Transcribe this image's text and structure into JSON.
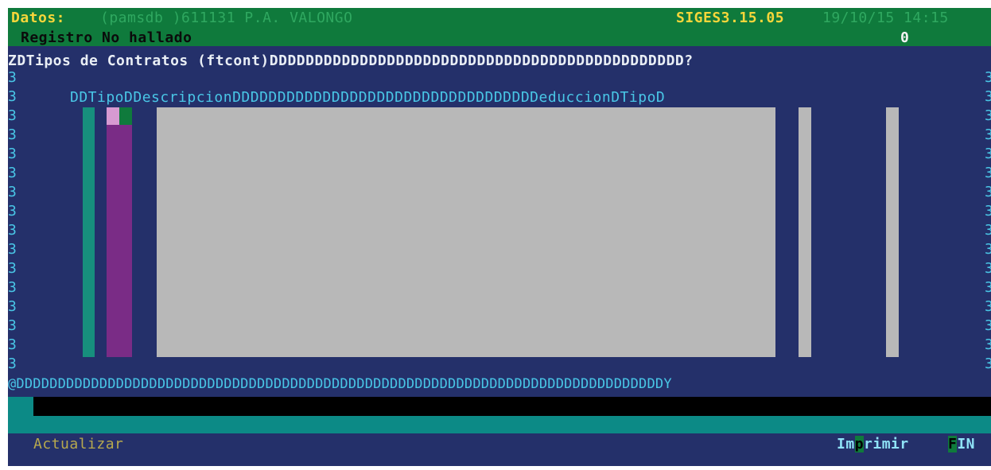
{
  "header": {
    "datos_label": "Datos:",
    "db_name": "(pamsdb  )611131 P.A. VALONGO",
    "app_version": "SIGES3.15.05",
    "datetime": "19/10/15 14:15",
    "status_message": "Registro No hallado",
    "record_count": "0"
  },
  "window": {
    "title_line": "ZDTipos de Contratos (ftcont)DDDDDDDDDDDDDDDDDDDDDDDDDDDDDDDDDDDDDDDDDDDDDD?",
    "column_header_line": "DDTipoDDescripcionDDDDDDDDDDDDDDDDDDDDDDDDDDDDDDDDDDeduccionDTipoD",
    "border_char": "3",
    "bottom_border": "@DDDDDDDDDDDDDDDDDDDDDDDDDDDDDDDDDDDDDDDDDDDDDDDDDDDDDDDDDDDDDDDDDDDDDDDDDDDDDDY"
  },
  "colors": {
    "header_bg": "#0f7a3c",
    "screen_bg": "#24306a",
    "text_cyan": "#49c6e6",
    "field_gray": "#b8b8b8",
    "field_teal": "#178f7d",
    "field_purple": "#7a2c86"
  },
  "footer": {
    "actualizar": "Actualizar",
    "imprimir_pre": "Im",
    "imprimir_key": "p",
    "imprimir_post": "rimir",
    "fin_key": "F",
    "fin_rest": "IN"
  }
}
